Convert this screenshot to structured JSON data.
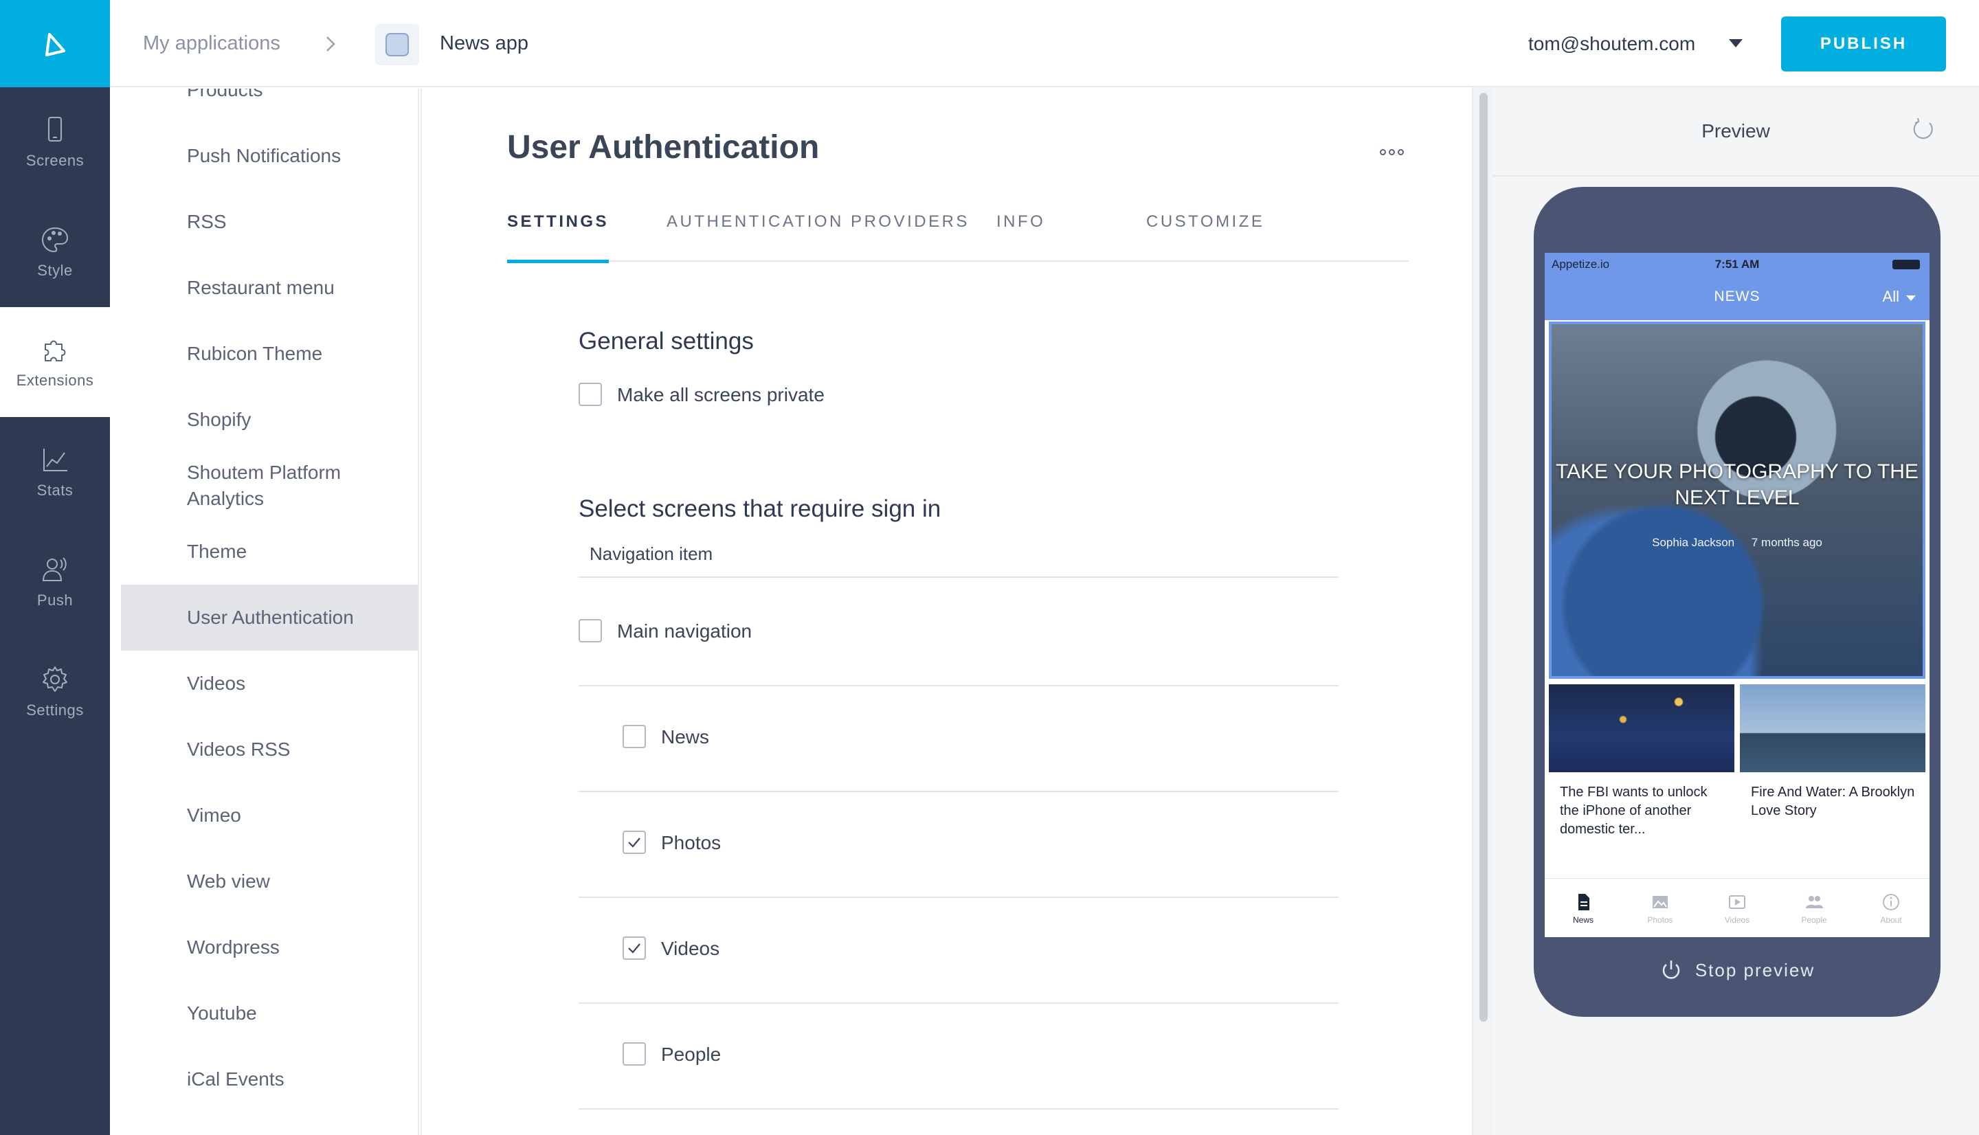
{
  "colors": {
    "rail_bg": "#2f3a52",
    "accent": "#00aee0",
    "preview_bar": "#6f98e8"
  },
  "rail": {
    "items": [
      {
        "label": "Screens",
        "icon": "phone-icon"
      },
      {
        "label": "Style",
        "icon": "palette-icon"
      },
      {
        "label": "Extensions",
        "icon": "puzzle-icon",
        "active": true
      },
      {
        "label": "Stats",
        "icon": "chart-icon"
      },
      {
        "label": "Push",
        "icon": "broadcast-icon"
      },
      {
        "label": "Settings",
        "icon": "gear-icon"
      }
    ]
  },
  "topbar": {
    "crumb_apps": "My applications",
    "crumb_app": "News app",
    "user_email": "tom@shoutem.com",
    "publish_label": "PUBLISH"
  },
  "extensions": {
    "items": [
      "Products",
      "Push Notifications",
      "RSS",
      "Restaurant menu",
      "Rubicon Theme",
      "Shopify",
      "Shoutem Platform Analytics",
      "Theme",
      "User Authentication",
      "Videos",
      "Videos RSS",
      "Vimeo",
      "Web view",
      "Wordpress",
      "Youtube",
      "iCal Events"
    ],
    "active": "User Authentication"
  },
  "main": {
    "title": "User Authentication",
    "tabs": [
      "SETTINGS",
      "AUTHENTICATION PROVIDERS",
      "INFO",
      "CUSTOMIZE"
    ],
    "active_tab": "SETTINGS",
    "general_heading": "General settings",
    "private_label": "Make all screens private",
    "private_checked": false,
    "screens_heading": "Select screens that require sign in",
    "nav_column_label": "Navigation item",
    "screens": [
      {
        "label": "Main navigation",
        "checked": false,
        "indent": 0
      },
      {
        "label": "News",
        "checked": false,
        "indent": 1
      },
      {
        "label": "Photos",
        "checked": true,
        "indent": 1
      },
      {
        "label": "Videos",
        "checked": true,
        "indent": 1
      },
      {
        "label": "People",
        "checked": false,
        "indent": 1
      }
    ]
  },
  "preview": {
    "title": "Preview",
    "status_carrier": "Appetize.io",
    "status_time": "7:51 AM",
    "nav_title": "NEWS",
    "nav_filter": "All",
    "hero_title": "TAKE YOUR PHOTOGRAPHY TO THE NEXT LEVEL",
    "hero_author": "Sophia Jackson",
    "hero_age": "7 months ago",
    "cards": [
      "The FBI wants to unlock the iPhone of another domestic ter...",
      "Fire And Water: A Brooklyn Love Story"
    ],
    "tabbar": [
      {
        "label": "News",
        "icon": "document-icon",
        "active": true
      },
      {
        "label": "Photos",
        "icon": "image-icon"
      },
      {
        "label": "Videos",
        "icon": "play-icon"
      },
      {
        "label": "People",
        "icon": "people-icon"
      },
      {
        "label": "About",
        "icon": "info-icon"
      }
    ],
    "stop_label": "Stop preview"
  }
}
